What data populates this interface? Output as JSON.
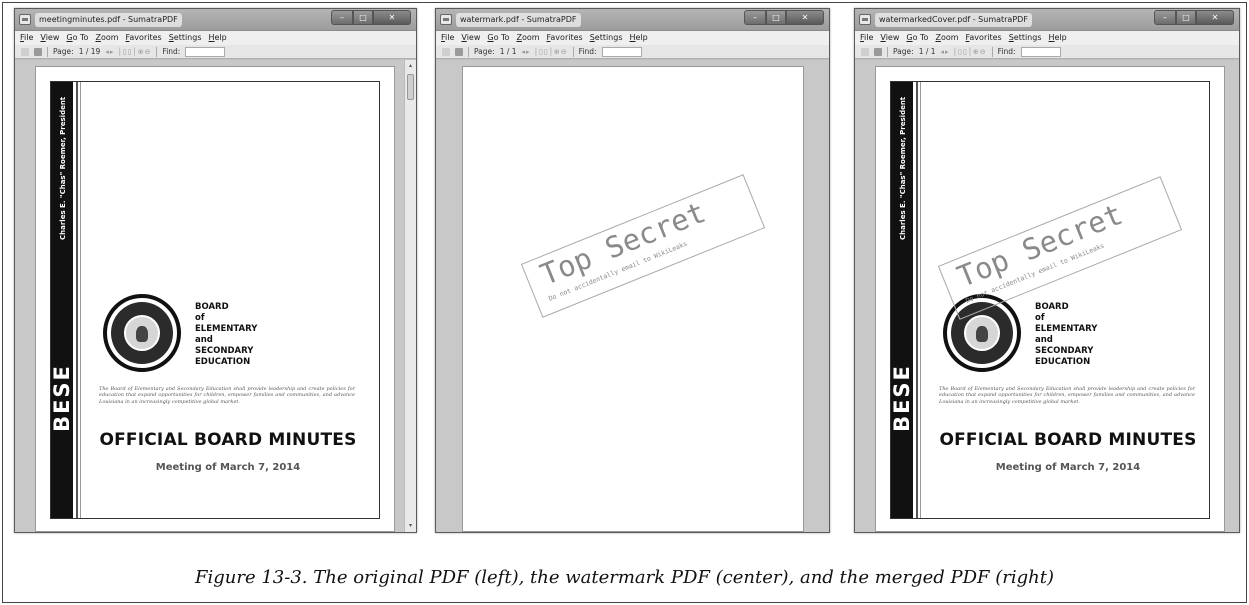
{
  "windows": [
    {
      "title": "meetingminutes.pdf - SumatraPDF",
      "page_indicator": "1 / 19",
      "show_cover": true,
      "show_watermark": false
    },
    {
      "title": "watermark.pdf - SumatraPDF",
      "page_indicator": "1 / 1",
      "show_cover": false,
      "show_watermark": true
    },
    {
      "title": "watermarkedCover.pdf - SumatraPDF",
      "page_indicator": "1 / 1",
      "show_cover": true,
      "show_watermark": true
    }
  ],
  "menu": [
    "File",
    "View",
    "Go To",
    "Zoom",
    "Favorites",
    "Settings",
    "Help"
  ],
  "toolbar": {
    "page_label": "Page:",
    "find_label": "Find:"
  },
  "cover": {
    "president": "Charles E. \"Chas\" Roemer, President",
    "side_title": "BESE",
    "board_lines": [
      "BOARD",
      "of",
      "ELEMENTARY",
      "and",
      "SECONDARY",
      "EDUCATION"
    ],
    "mission": "The Board of Elementary and Secondary Education shall provide leadership and create policies for education that expand opportunities for children, empower families and communities, and advance Louisiana in an increasingly competitive global market.",
    "heading": "OFFICIAL BOARD MINUTES",
    "meeting": "Meeting of March 7, 2014"
  },
  "watermark": {
    "main": "Top Secret",
    "sub": "Do not accidentally email to WikiLeaks"
  },
  "caption": "Figure 13-3. The original PDF (left), the watermark PDF (center), and the merged PDF (right)"
}
